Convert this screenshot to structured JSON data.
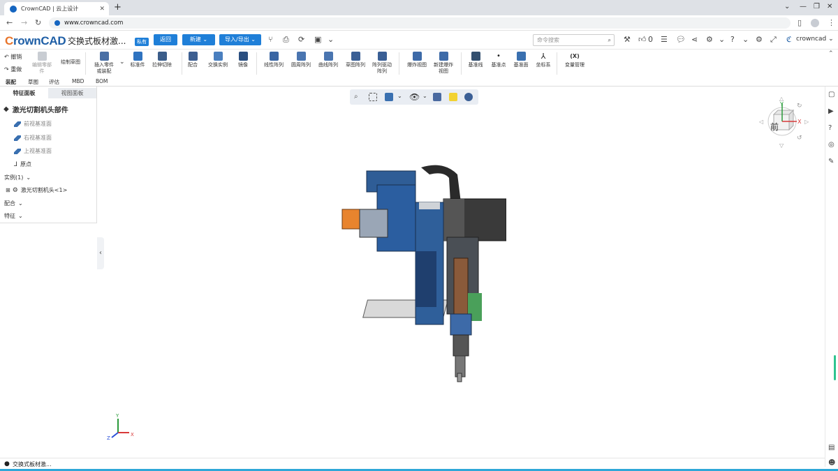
{
  "browser": {
    "tab_title": "CrownCAD | 云上设计",
    "url": "www.crowncad.com"
  },
  "app": {
    "brand_prefix": "C",
    "brand_rest": "rownCAD",
    "doc_title": "交换式板材激...",
    "private_badge": "私有",
    "back_label": "返回",
    "new_label": "新建",
    "import_export_label": "导入/导出",
    "search_placeholder": "命令搜索",
    "like_count": "0",
    "username": "crowncad"
  },
  "toolbar": {
    "undo": "撤销",
    "redo": "重做",
    "edit_part": "编辑零部件",
    "draw_sketch": "绘制草图",
    "insert_part": "插入零件或装配",
    "standard_part": "标准件",
    "stretch_cut": "拉伸切除",
    "mate": "配合",
    "swap_instance": "交换实例",
    "mirror": "镜像",
    "linear_pattern": "线性阵列",
    "circular_pattern": "圆周阵列",
    "curve_pattern": "曲线阵列",
    "sketch_pattern": "草图阵列",
    "pattern_driven": "阵列驱动阵列",
    "explode_view": "爆炸视图",
    "new_explode_view": "新建爆炸视图",
    "ref_line": "基准线",
    "ref_point": "基准点",
    "ref_plane": "基准面",
    "coord_system": "坐标系",
    "var_manage": "变量管理",
    "var_icon": "(X)"
  },
  "subtabs": [
    "装配",
    "草图",
    "评估",
    "MBD",
    "BOM"
  ],
  "panel": {
    "tab_feature": "特征面板",
    "tab_view": "视图面板",
    "assembly_title": "激光切割机头部件",
    "front_plane": "前视基准面",
    "right_plane": "右视基准面",
    "top_plane": "上视基准面",
    "origin": "原点",
    "instances": "实例(1)",
    "instance_item": "激光切割机头<1>",
    "mates": "配合",
    "features": "特征"
  },
  "viewcube": {
    "face_label": "前",
    "axis_y": "Y",
    "axis_x": "X",
    "axis_z": "Z"
  },
  "triad": {
    "x": "X",
    "y": "Y",
    "z": "Z"
  },
  "status": {
    "doc_name": "交换式板材激..."
  }
}
